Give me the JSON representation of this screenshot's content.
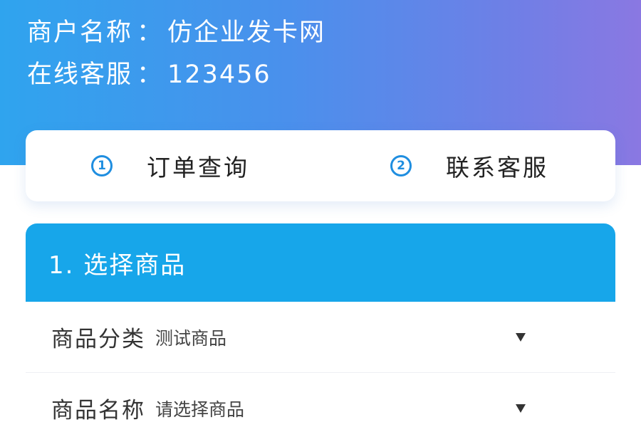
{
  "merchant": {
    "name_label": "商户名称",
    "name_value": "仿企业发卡网",
    "service_label": "在线客服",
    "service_value": "123456",
    "separator": "："
  },
  "quick_actions": [
    {
      "number": "1",
      "label": "订单查询"
    },
    {
      "number": "2",
      "label": "联系客服"
    }
  ],
  "section": {
    "title": "1. 选择商品",
    "fields": [
      {
        "label": "商品分类",
        "value": "测试商品"
      },
      {
        "label": "商品名称",
        "value": "请选择商品"
      }
    ]
  },
  "colors": {
    "accent": "#17a6ea",
    "number_circle": "#1f8ee0",
    "header_gradient_start": "#2fa4ee",
    "header_gradient_end": "#8a78e2"
  },
  "icons": {
    "quick_number": "circled-number-icon",
    "dropdown": "caret-down-icon"
  }
}
